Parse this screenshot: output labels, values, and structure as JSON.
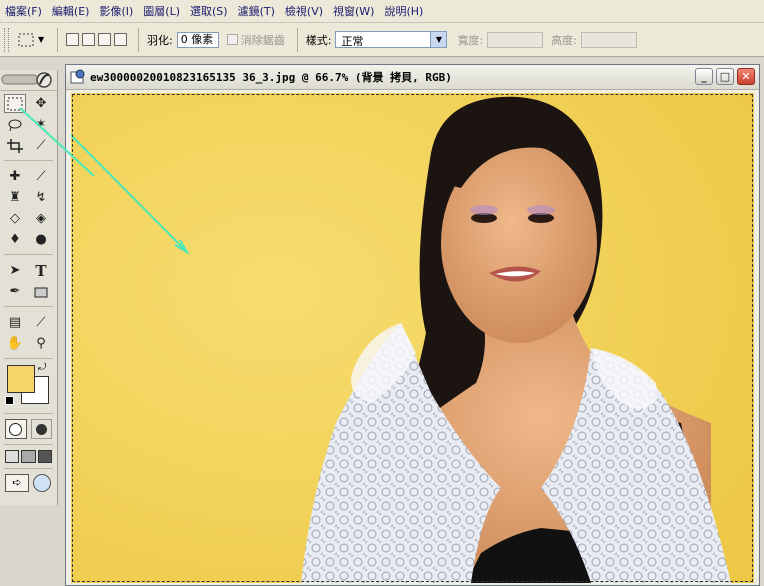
{
  "menu": {
    "items": [
      "檔案(F)",
      "編輯(E)",
      "影像(I)",
      "圖層(L)",
      "選取(S)",
      "濾鏡(T)",
      "檢視(V)",
      "視窗(W)",
      "說明(H)"
    ]
  },
  "options": {
    "feather_label": "羽化:",
    "feather_value": "0 像素",
    "antialias_label": "消除鋸齒",
    "style_label": "樣式:",
    "style_value": "正常",
    "width_label": "寬度:",
    "height_label": "高度:"
  },
  "document": {
    "title": "ew30000020010823165135 36_3.jpg @ 66.7% (背景 拷貝, RGB)",
    "minimize_label": "_",
    "maximize_label": "□",
    "close_label": "✕"
  },
  "colors": {
    "foreground": "#f5d46a",
    "background": "#ffffff",
    "canvas_bg": "#f3d45a",
    "annotation_arrow": "#49e8b9",
    "close_button": "#d9534a"
  },
  "tools": [
    "rect-marquee-icon",
    "move-icon",
    "lasso-icon",
    "magic-wand-icon",
    "crop-icon",
    "slice-icon",
    "healing-brush-icon",
    "brush-icon",
    "clone-stamp-icon",
    "history-brush-icon",
    "eraser-icon",
    "paint-bucket-icon",
    "blur-icon",
    "dodge-icon",
    "path-select-icon",
    "type-icon",
    "pen-icon",
    "shape-icon",
    "notes-icon",
    "eyedropper-icon",
    "hand-icon",
    "zoom-icon"
  ]
}
